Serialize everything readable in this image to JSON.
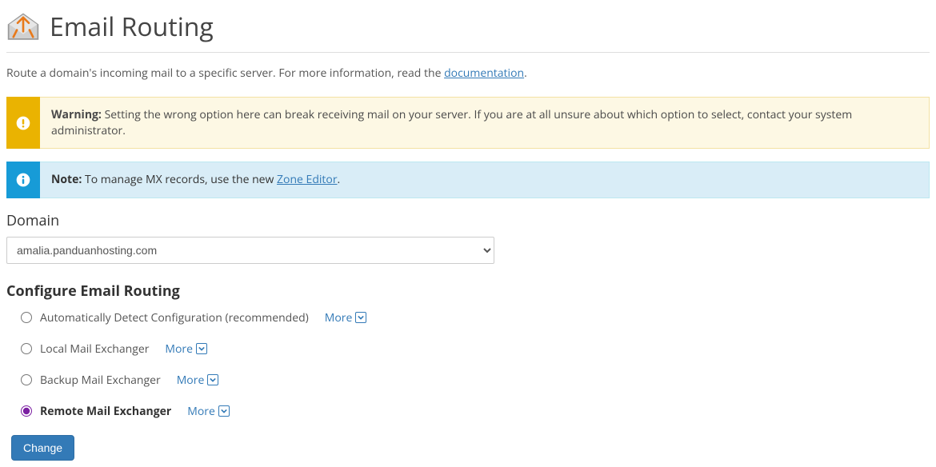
{
  "header": {
    "title": "Email Routing"
  },
  "description": {
    "prefix": "Route a domain's incoming mail to a specific server. For more information, read the ",
    "link_text": "documentation",
    "suffix": "."
  },
  "warning": {
    "label": "Warning:",
    "text": " Setting the wrong option here can break receiving mail on your server. If you are at all unsure about which option to select, contact your system administrator."
  },
  "note": {
    "label": "Note:",
    "prefix": " To manage MX records, use the new ",
    "link_text": "Zone Editor",
    "suffix": "."
  },
  "domain": {
    "label": "Domain",
    "selected": "amalia.panduanhosting.com"
  },
  "config": {
    "title": "Configure Email Routing",
    "more_label": "More",
    "options": [
      {
        "label": "Automatically Detect Configuration (recommended)",
        "selected": false
      },
      {
        "label": "Local Mail Exchanger",
        "selected": false
      },
      {
        "label": "Backup Mail Exchanger",
        "selected": false
      },
      {
        "label": "Remote Mail Exchanger",
        "selected": true
      }
    ]
  },
  "actions": {
    "change": "Change"
  }
}
